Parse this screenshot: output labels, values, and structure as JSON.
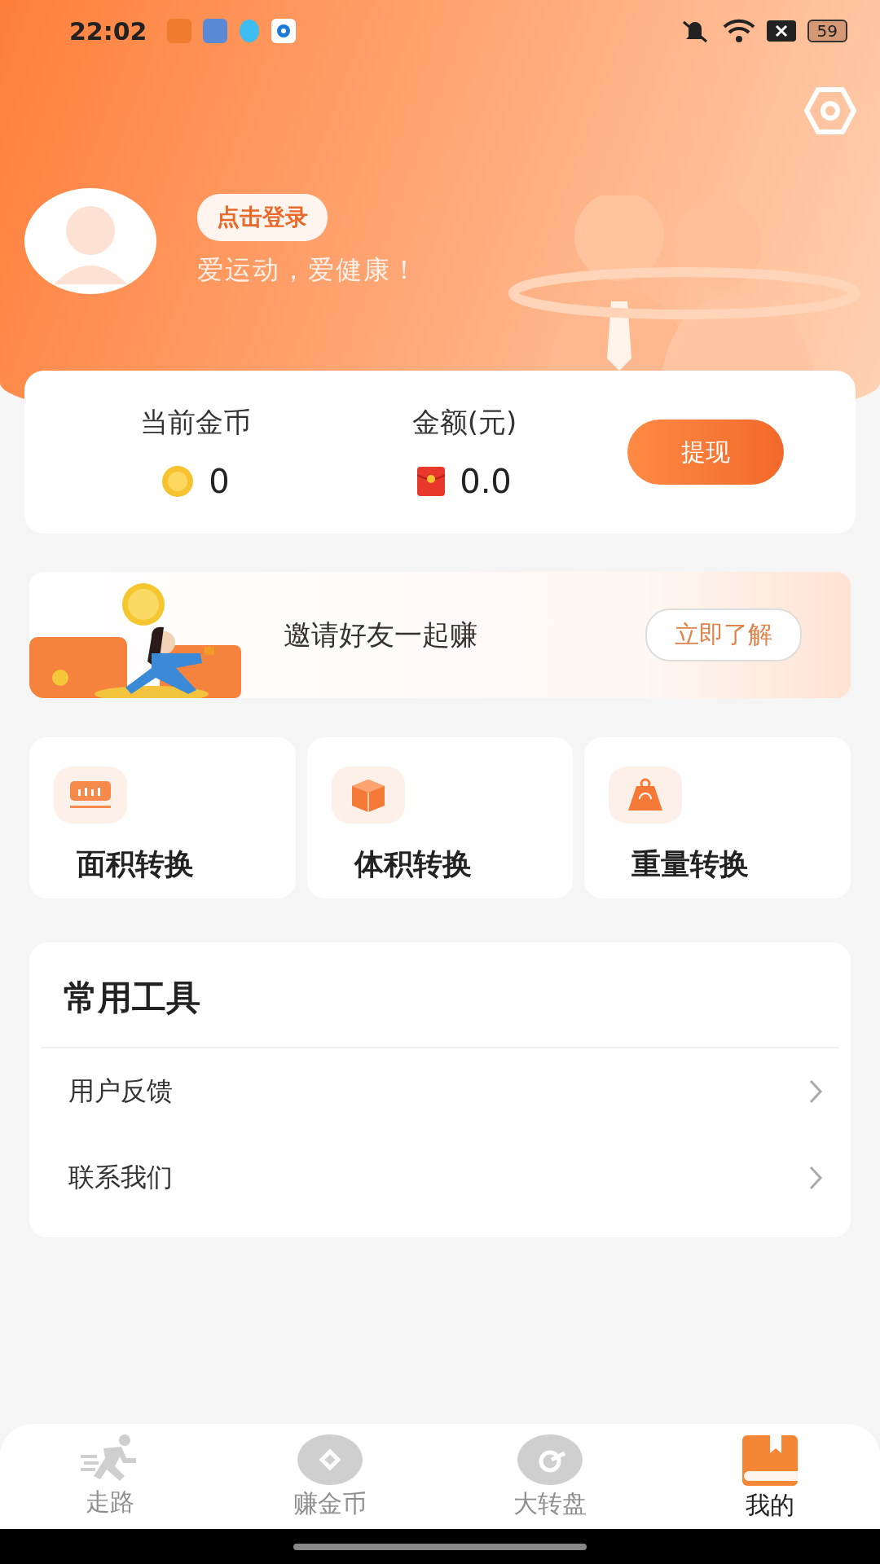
{
  "status_bar": {
    "time": "22:02",
    "battery": "59"
  },
  "profile": {
    "login_button": "点击登录",
    "slogan": "爱运动，爱健康！"
  },
  "balance": {
    "items": [
      {
        "label": "当前金币",
        "value": "0",
        "kind": "coin"
      },
      {
        "label": "金额(元)",
        "value": "0.0",
        "kind": "redpacket"
      }
    ],
    "withdraw_button": "提现"
  },
  "invite_banner": {
    "title": "邀请好友一起赚",
    "button": "立即了解"
  },
  "converters": [
    {
      "label": "面积转换",
      "kind": "area"
    },
    {
      "label": "体积转换",
      "kind": "volume"
    },
    {
      "label": "重量转换",
      "kind": "weight"
    }
  ],
  "tools": {
    "title": "常用工具",
    "items": [
      "用户反馈",
      "联系我们"
    ]
  },
  "tab_bar": [
    {
      "label": "走路",
      "kind": "run",
      "selected": false
    },
    {
      "label": "赚金币",
      "kind": "coin",
      "selected": false
    },
    {
      "label": "大转盘",
      "kind": "wheel",
      "selected": false
    },
    {
      "label": "我的",
      "kind": "book",
      "selected": true
    }
  ]
}
